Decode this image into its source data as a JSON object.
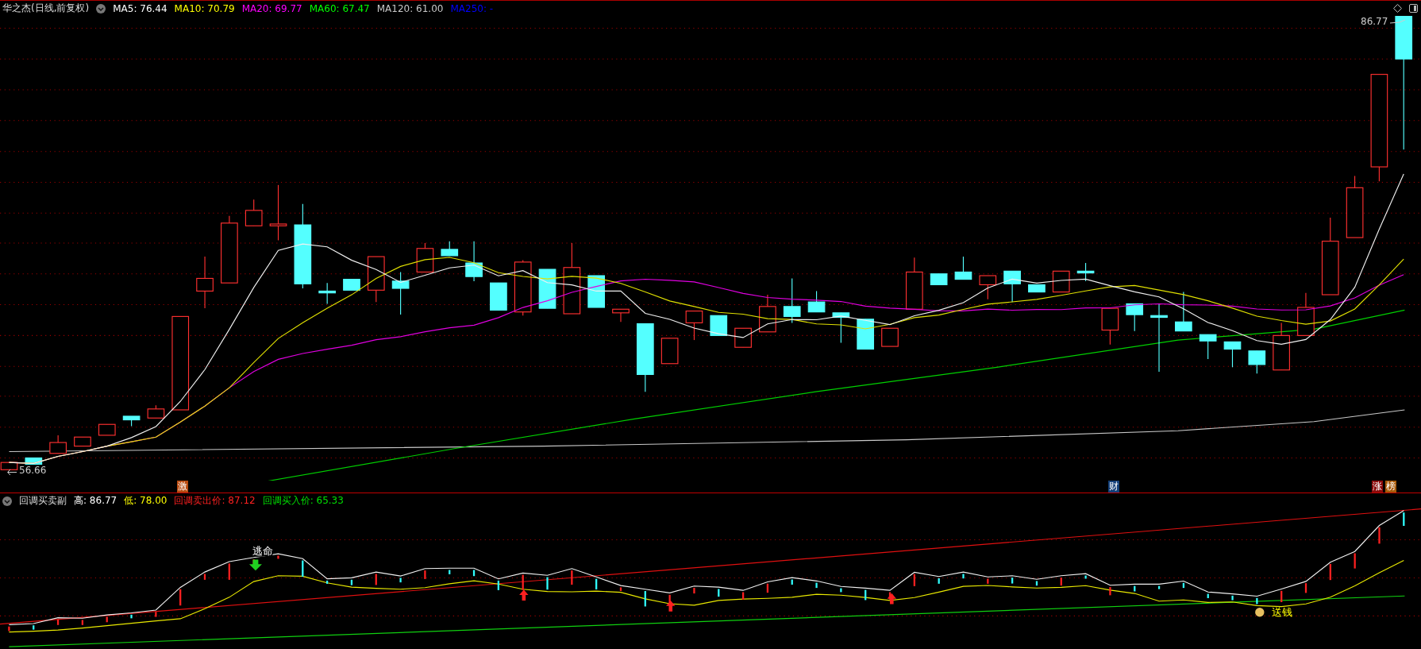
{
  "header": {
    "title": "华之杰(日线,前复权)",
    "indicators": [
      {
        "label": "MA5: 76.44",
        "color": "#ffffff"
      },
      {
        "label": "MA10: 70.79",
        "color": "#ffff00"
      },
      {
        "label": "MA20: 69.77",
        "color": "#ff00ff"
      },
      {
        "label": "MA60: 67.47",
        "color": "#00ff00"
      },
      {
        "label": "MA120: 61.00",
        "color": "#c8c8c8"
      },
      {
        "label": "MA250: -",
        "color": "#0000ff"
      }
    ]
  },
  "price_chart": {
    "high_label": "86.77",
    "low_label": "56.66",
    "markers": [
      {
        "text": "激",
        "color": "#b84a10"
      },
      {
        "text": "财",
        "color": "#123e78"
      },
      {
        "text": "涨",
        "color": "#8a0a0a"
      },
      {
        "text": "榜",
        "color": "#a85a08"
      }
    ]
  },
  "sub_chart": {
    "title": "回调买卖副",
    "readings": [
      {
        "label": "高: 86.77",
        "color": "#ffffff"
      },
      {
        "label": "低: 78.00",
        "color": "#ffff00"
      },
      {
        "label": "回调卖出价: 87.12",
        "color": "#ff2020"
      },
      {
        "label": "回调买入价: 65.33",
        "color": "#00e000"
      }
    ],
    "signals": [
      {
        "kind": "sell",
        "text": "逃命"
      },
      {
        "kind": "buy",
        "text": "送钱"
      }
    ]
  }
}
